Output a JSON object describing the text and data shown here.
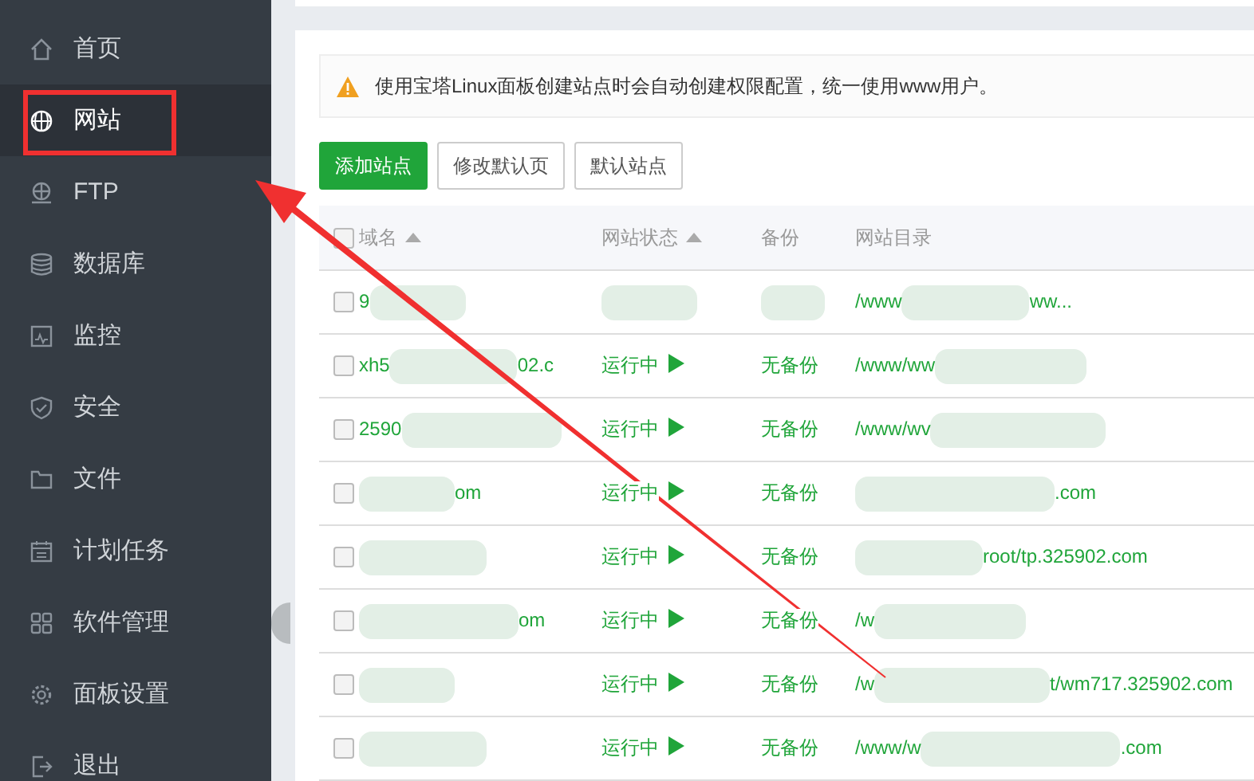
{
  "sidebar": {
    "items": [
      {
        "label": "首页",
        "selected": false
      },
      {
        "label": "网站",
        "selected": true
      },
      {
        "label": "FTP",
        "selected": false
      },
      {
        "label": "数据库",
        "selected": false
      },
      {
        "label": "监控",
        "selected": false
      },
      {
        "label": "安全",
        "selected": false
      },
      {
        "label": "文件",
        "selected": false
      },
      {
        "label": "计划任务",
        "selected": false
      },
      {
        "label": "软件管理",
        "selected": false
      },
      {
        "label": "面板设置",
        "selected": false
      },
      {
        "label": "退出",
        "selected": false
      }
    ]
  },
  "notice": "使用宝塔Linux面板创建站点时会自动创建权限配置，统一使用www用户。",
  "buttons": [
    {
      "label": "添加站点",
      "kind": "primary"
    },
    {
      "label": "修改默认页",
      "kind": "default"
    },
    {
      "label": "默认站点",
      "kind": "default"
    }
  ],
  "table": {
    "all_checked": false,
    "columns": [
      {
        "label": "域名",
        "sortable": true
      },
      {
        "label": "网站状态",
        "sortable": true
      },
      {
        "label": "备份",
        "sortable": false
      },
      {
        "label": "网站目录",
        "sortable": false
      }
    ],
    "rows": [
      {
        "checked": false,
        "domain": "9",
        "dir": "/www",
        "dir_tail": "ww..."
      },
      {
        "checked": false,
        "domain": "xh5",
        "domain_tail": "02.c",
        "status": "运行中",
        "backup": "无备份",
        "dir": "/www/ww"
      },
      {
        "checked": false,
        "domain": "2590",
        "status": "运行中",
        "backup": "无备份",
        "dir": "/www/wv"
      },
      {
        "checked": false,
        "domain_tail": "om",
        "status": "运行中",
        "backup": "无备份",
        "dir_tail": ".com"
      },
      {
        "checked": false,
        "status": "运行中",
        "backup": "无备份",
        "dir_tail": "root/tp.325902.com"
      },
      {
        "checked": false,
        "domain_tail": "om",
        "status": "运行中",
        "backup": "无备份",
        "dir": "/w"
      },
      {
        "checked": false,
        "status": "运行中",
        "backup": "无备份",
        "dir": "/w",
        "dir_tail": "t/wm717.325902.com"
      },
      {
        "checked": false,
        "status": "运行中",
        "backup": "无备份",
        "dir": "/www/w",
        "dir_tail": ".com"
      }
    ]
  }
}
